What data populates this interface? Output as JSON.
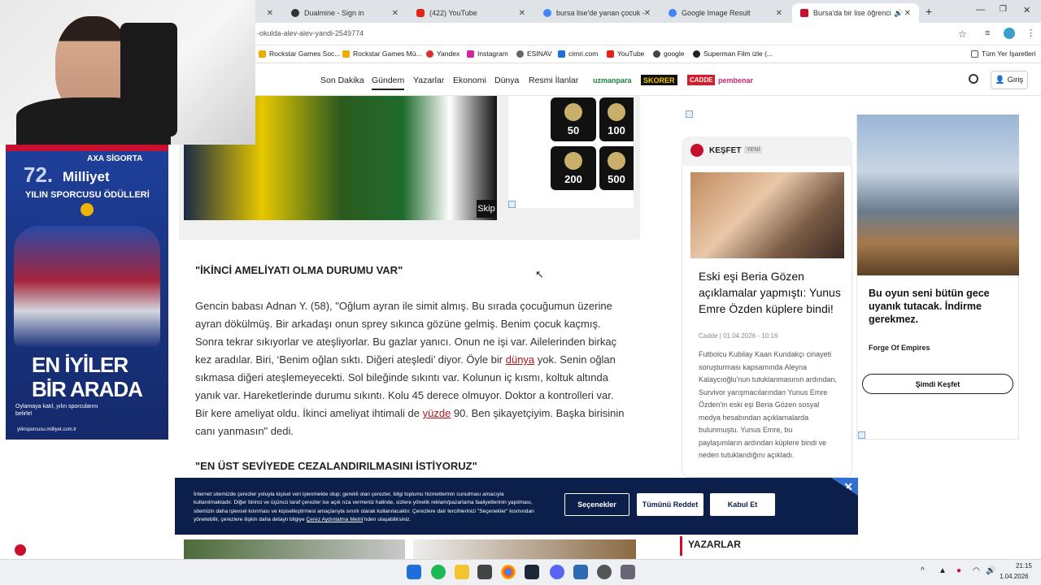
{
  "browser": {
    "tabs": [
      {
        "label": "",
        "icon": "x-close-icon"
      },
      {
        "label": "Dualmine - Sign in"
      },
      {
        "label": "(422) YouTube"
      },
      {
        "label": "bursa lise'de yanan çocuk - Go"
      },
      {
        "label": "Google Image Result"
      },
      {
        "label": "Bursa'da bir lise öğrencisi, a"
      }
    ],
    "url": "-okulda-alev-alev-yandi-2549774",
    "bookmarks": [
      "Rockstar Games Soc...",
      "Rockstar Games Mü...",
      "Yandex",
      "Instagram",
      "ESINAV",
      "cimri.com",
      "YouTube",
      "google",
      "Superman Film izle (..."
    ],
    "all_bookmarks": "Tüm Yer İşaretleri"
  },
  "site_nav": {
    "items": [
      "Son Dakika",
      "Gündem",
      "Yazarlar",
      "Ekonomi",
      "Dünya",
      "Resmi İlanlar"
    ],
    "active": "Gündem",
    "brands": [
      "uzmanpara",
      "SKORER",
      "CADDE",
      "pembenar"
    ],
    "login": "Giriş"
  },
  "video": {
    "skip": "Skip"
  },
  "coins": [
    "50",
    "100",
    "200",
    "500"
  ],
  "article": {
    "heading1": "\"İKİNCİ AMELİYATI OLMA DURUMU VAR\"",
    "p_pre": "Gencin babası Adnan Y. (58), \"Oğlum ayran ile simit almış. Bu sırada çocuğumun üzerine ayran dökülmüş. Bir arkadaşı onun sprey sıkınca gözüne gelmiş. Benim çocuk kaçmış. Sonra tekrar sıkıyorlar ve ateşliyorlar. Bu gazlar yanıcı. Onun ne işi var. Ailelerinden birkaç kez aradılar. Biri, ‘Benim oğlan sıktı. Diğeri ateşledi’ diyor. Öyle bir ",
    "link1": "dünya",
    "p_mid": " yok. Senin oğlan sıkmasa diğeri ateşlemeyecekti. Sol bileğinde sıkıntı var. Kolunun iç kısmı, koltuk altında yanık var. Hareketlerinde durumu sıkıntı. Kolu 45 derece olmuyor. Doktor a kontrolleri var. Bir kere ameliyat oldu. İkinci ameliyat ihtimali de ",
    "link2": "yüzde",
    "p_post": " 90. Ben şikayetçiyim. Başka birisinin canı yanmasın\" dedi.",
    "heading2": "\"EN ÜST SEVİYEDE CEZALANDIRILMASINI İSTİYORUZ\""
  },
  "left_ad": {
    "sponsor": "AXA SİGORTA",
    "edition": "72.",
    "brand": "Milliyet",
    "title": "YILIN SPORCUSU ÖDÜLLERİ",
    "headline1": "EN İYİLER",
    "headline2": "BİR ARADA",
    "cta": "Oylamaya katıl, yılın sporcularını belirle!",
    "url": "yilinsporcusu.milliyet.com.tr"
  },
  "kesfet": {
    "title": "KEŞFET",
    "badge": "YENİ",
    "card_title": "Eski eşi Beria Gözen açıklamalar yapmıştı: Yunus Emre Özden küplere bindi!",
    "card_meta": "Cadde | 01.04.2026 - 10:16",
    "card_body": "Futbolcu Kubilay Kaan Kundakçı cinayeti soruşturması kapsamında Aleyna Kalaycıoğlu'nun tutuklanmasının ardından, Survivor yarışmacılarından Yunus Emre Özden'in eski eşi Beria Gözen sosyal medya hesabından açıklamalarda bulunmuştu. Yunus Emre, bu paylaşımların ardından küplere bindi ve neden tutuklandığını açıkladı."
  },
  "game_ad": {
    "headline": "Bu oyun seni bütün gece uyanık tutacak. İndirme gerekmez.",
    "name": "Forge Of Empires",
    "cta": "Şimdi Keşfet"
  },
  "yazarlar": "YAZARLAR",
  "cookie": {
    "text": "İnternet sitemizde çerezler yoluyla kişisel veri işlenmekte olup; gerekli olan çerezler, bilgi toplumu hizmetlerinin sunulması amacıyla kullanılmaktadır. Diğer birinci ve üçüncü taraf çerezler ise açık rıza vermeniz halinde, sizlere yönelik reklam/pazarlama faaliyetlerinin yapılması, sitemizin daha işlevsel kılınması ve kişiselleştirmesi amaçlarıyla sınırlı olarak kullanılacaktır. Çerezlere dair tercihlerinizi \"Seçenekler\" kısmından yönetebilir, çerezlere ilişkin daha detaylı bilgiye ",
    "link": "Çerez Aydınlatma Metni",
    "text_end": "'nden ulaşabilirsiniz.",
    "options": "Seçenekler",
    "reject": "Tümünü Reddet",
    "accept": "Kabul Et"
  },
  "taskbar": {
    "time": "21:15",
    "date": "1.04.2026"
  },
  "colors": {
    "accent_red": "#b0151e",
    "cookie_bg": "#0b1f4a",
    "ad_blue": "#1f3f9b"
  }
}
